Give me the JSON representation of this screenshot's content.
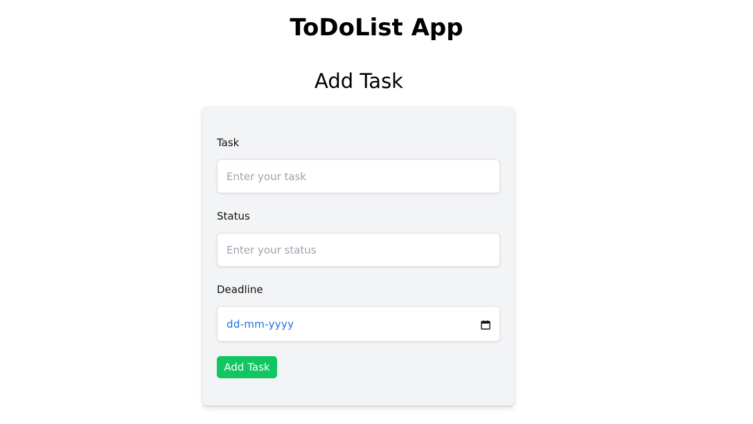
{
  "app": {
    "title": "ToDoList App"
  },
  "form": {
    "heading": "Add Task",
    "task": {
      "label": "Task",
      "value": "",
      "placeholder": "Enter your task"
    },
    "status": {
      "label": "Status",
      "value": "",
      "placeholder": "Enter your status"
    },
    "deadline": {
      "label": "Deadline",
      "value": "dd-mm-yyyy",
      "icon": "calendar-icon"
    },
    "submit_label": "Add Task"
  },
  "colors": {
    "card_background": "#f3f4f6",
    "button_background": "#0fc660",
    "date_text": "#1f6fd8",
    "placeholder_text": "#9ca3af"
  }
}
